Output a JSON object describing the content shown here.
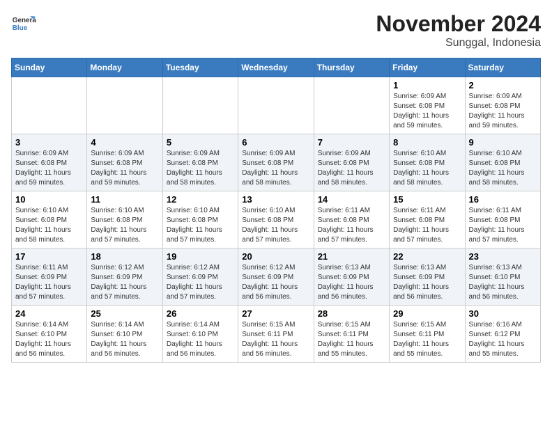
{
  "header": {
    "logo_general": "General",
    "logo_blue": "Blue",
    "month_title": "November 2024",
    "subtitle": "Sunggal, Indonesia"
  },
  "weekdays": [
    "Sunday",
    "Monday",
    "Tuesday",
    "Wednesday",
    "Thursday",
    "Friday",
    "Saturday"
  ],
  "weeks": [
    [
      {
        "day": "",
        "info": ""
      },
      {
        "day": "",
        "info": ""
      },
      {
        "day": "",
        "info": ""
      },
      {
        "day": "",
        "info": ""
      },
      {
        "day": "",
        "info": ""
      },
      {
        "day": "1",
        "info": "Sunrise: 6:09 AM\nSunset: 6:08 PM\nDaylight: 11 hours and 59 minutes."
      },
      {
        "day": "2",
        "info": "Sunrise: 6:09 AM\nSunset: 6:08 PM\nDaylight: 11 hours and 59 minutes."
      }
    ],
    [
      {
        "day": "3",
        "info": "Sunrise: 6:09 AM\nSunset: 6:08 PM\nDaylight: 11 hours and 59 minutes."
      },
      {
        "day": "4",
        "info": "Sunrise: 6:09 AM\nSunset: 6:08 PM\nDaylight: 11 hours and 59 minutes."
      },
      {
        "day": "5",
        "info": "Sunrise: 6:09 AM\nSunset: 6:08 PM\nDaylight: 11 hours and 58 minutes."
      },
      {
        "day": "6",
        "info": "Sunrise: 6:09 AM\nSunset: 6:08 PM\nDaylight: 11 hours and 58 minutes."
      },
      {
        "day": "7",
        "info": "Sunrise: 6:09 AM\nSunset: 6:08 PM\nDaylight: 11 hours and 58 minutes."
      },
      {
        "day": "8",
        "info": "Sunrise: 6:10 AM\nSunset: 6:08 PM\nDaylight: 11 hours and 58 minutes."
      },
      {
        "day": "9",
        "info": "Sunrise: 6:10 AM\nSunset: 6:08 PM\nDaylight: 11 hours and 58 minutes."
      }
    ],
    [
      {
        "day": "10",
        "info": "Sunrise: 6:10 AM\nSunset: 6:08 PM\nDaylight: 11 hours and 58 minutes."
      },
      {
        "day": "11",
        "info": "Sunrise: 6:10 AM\nSunset: 6:08 PM\nDaylight: 11 hours and 57 minutes."
      },
      {
        "day": "12",
        "info": "Sunrise: 6:10 AM\nSunset: 6:08 PM\nDaylight: 11 hours and 57 minutes."
      },
      {
        "day": "13",
        "info": "Sunrise: 6:10 AM\nSunset: 6:08 PM\nDaylight: 11 hours and 57 minutes."
      },
      {
        "day": "14",
        "info": "Sunrise: 6:11 AM\nSunset: 6:08 PM\nDaylight: 11 hours and 57 minutes."
      },
      {
        "day": "15",
        "info": "Sunrise: 6:11 AM\nSunset: 6:08 PM\nDaylight: 11 hours and 57 minutes."
      },
      {
        "day": "16",
        "info": "Sunrise: 6:11 AM\nSunset: 6:08 PM\nDaylight: 11 hours and 57 minutes."
      }
    ],
    [
      {
        "day": "17",
        "info": "Sunrise: 6:11 AM\nSunset: 6:09 PM\nDaylight: 11 hours and 57 minutes."
      },
      {
        "day": "18",
        "info": "Sunrise: 6:12 AM\nSunset: 6:09 PM\nDaylight: 11 hours and 57 minutes."
      },
      {
        "day": "19",
        "info": "Sunrise: 6:12 AM\nSunset: 6:09 PM\nDaylight: 11 hours and 57 minutes."
      },
      {
        "day": "20",
        "info": "Sunrise: 6:12 AM\nSunset: 6:09 PM\nDaylight: 11 hours and 56 minutes."
      },
      {
        "day": "21",
        "info": "Sunrise: 6:13 AM\nSunset: 6:09 PM\nDaylight: 11 hours and 56 minutes."
      },
      {
        "day": "22",
        "info": "Sunrise: 6:13 AM\nSunset: 6:09 PM\nDaylight: 11 hours and 56 minutes."
      },
      {
        "day": "23",
        "info": "Sunrise: 6:13 AM\nSunset: 6:10 PM\nDaylight: 11 hours and 56 minutes."
      }
    ],
    [
      {
        "day": "24",
        "info": "Sunrise: 6:14 AM\nSunset: 6:10 PM\nDaylight: 11 hours and 56 minutes."
      },
      {
        "day": "25",
        "info": "Sunrise: 6:14 AM\nSunset: 6:10 PM\nDaylight: 11 hours and 56 minutes."
      },
      {
        "day": "26",
        "info": "Sunrise: 6:14 AM\nSunset: 6:10 PM\nDaylight: 11 hours and 56 minutes."
      },
      {
        "day": "27",
        "info": "Sunrise: 6:15 AM\nSunset: 6:11 PM\nDaylight: 11 hours and 56 minutes."
      },
      {
        "day": "28",
        "info": "Sunrise: 6:15 AM\nSunset: 6:11 PM\nDaylight: 11 hours and 55 minutes."
      },
      {
        "day": "29",
        "info": "Sunrise: 6:15 AM\nSunset: 6:11 PM\nDaylight: 11 hours and 55 minutes."
      },
      {
        "day": "30",
        "info": "Sunrise: 6:16 AM\nSunset: 6:12 PM\nDaylight: 11 hours and 55 minutes."
      }
    ]
  ]
}
